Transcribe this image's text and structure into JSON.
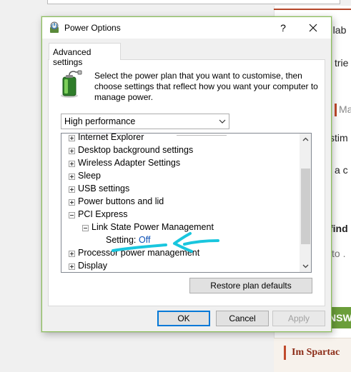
{
  "background_page": {
    "snippets": [
      "a lab",
      "trie",
      "Ma",
      "stim",
      "l a c",
      "find",
      "to .",
      "Im Spartac"
    ],
    "green_button_label": "NSWE"
  },
  "dialog": {
    "title": "Power Options",
    "help_label": "?",
    "tab_label": "Advanced settings",
    "description": "Select the power plan that you want to customise, then choose settings that reflect how you want your computer to manage power.",
    "plan_select": {
      "selected": "High performance"
    },
    "tree": [
      {
        "label": "Internet Explorer",
        "level": 0,
        "expander": "plus"
      },
      {
        "label": "Desktop background settings",
        "level": 0,
        "expander": "plus"
      },
      {
        "label": "Wireless Adapter Settings",
        "level": 0,
        "expander": "plus"
      },
      {
        "label": "Sleep",
        "level": 0,
        "expander": "plus"
      },
      {
        "label": "USB settings",
        "level": 0,
        "expander": "plus"
      },
      {
        "label": "Power buttons and lid",
        "level": 0,
        "expander": "plus"
      },
      {
        "label": "PCI Express",
        "level": 0,
        "expander": "minus"
      },
      {
        "label": "Link State Power Management",
        "level": 1,
        "expander": "minus"
      },
      {
        "label": "Setting:",
        "value": "Off",
        "level": 2,
        "expander": "none"
      },
      {
        "label": "Processor power management",
        "level": 0,
        "expander": "plus"
      },
      {
        "label": "Display",
        "level": 0,
        "expander": "plus"
      }
    ],
    "buttons": {
      "restore": "Restore plan defaults",
      "ok": "OK",
      "cancel": "Cancel",
      "apply": "Apply"
    }
  },
  "colors": {
    "window_border": "#8cbf5a",
    "setting_value": "#0b4fb5",
    "annotation": "#19c6de",
    "ok_focus": "#0078d7"
  },
  "icons": [
    "power-options-app-icon",
    "help-icon",
    "close-icon",
    "battery-icon",
    "chevron-down-icon",
    "expand-icon",
    "collapse-icon",
    "scroll-up-icon",
    "scroll-down-icon"
  ]
}
